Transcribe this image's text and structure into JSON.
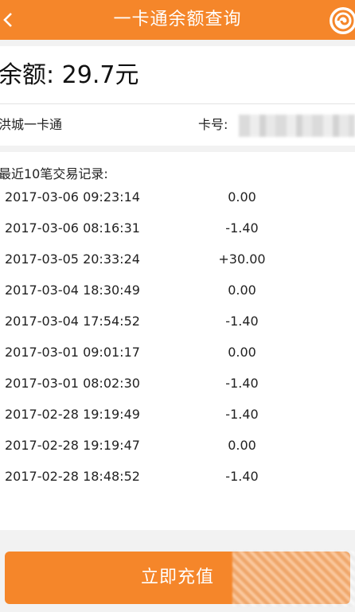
{
  "header": {
    "title": "一卡通余额查询",
    "back_icon": "chevron-left-icon",
    "logo_icon": "app-logo-icon"
  },
  "balance": {
    "text": "余额: 29.7元"
  },
  "card": {
    "name": "洪城一卡通",
    "number_label": "卡号:"
  },
  "records": {
    "title": "最近10笔交易记录:",
    "items": [
      {
        "time": "2017-03-06 09:23:14",
        "amount": "0.00"
      },
      {
        "time": "2017-03-06 08:16:31",
        "amount": "-1.40"
      },
      {
        "time": "2017-03-05 20:33:24",
        "amount": "+30.00"
      },
      {
        "time": "2017-03-04 18:30:49",
        "amount": "0.00"
      },
      {
        "time": "2017-03-04 17:54:52",
        "amount": "-1.40"
      },
      {
        "time": "2017-03-01 09:01:17",
        "amount": "0.00"
      },
      {
        "time": "2017-03-01 08:02:30",
        "amount": "-1.40"
      },
      {
        "time": "2017-02-28 19:19:49",
        "amount": "-1.40"
      },
      {
        "time": "2017-02-28 19:19:47",
        "amount": "0.00"
      },
      {
        "time": "2017-02-28 18:48:52",
        "amount": "-1.40"
      }
    ]
  },
  "action": {
    "recharge_label": "立即充值"
  },
  "colors": {
    "accent": "#f5862a",
    "background": "#f2f2f2"
  }
}
